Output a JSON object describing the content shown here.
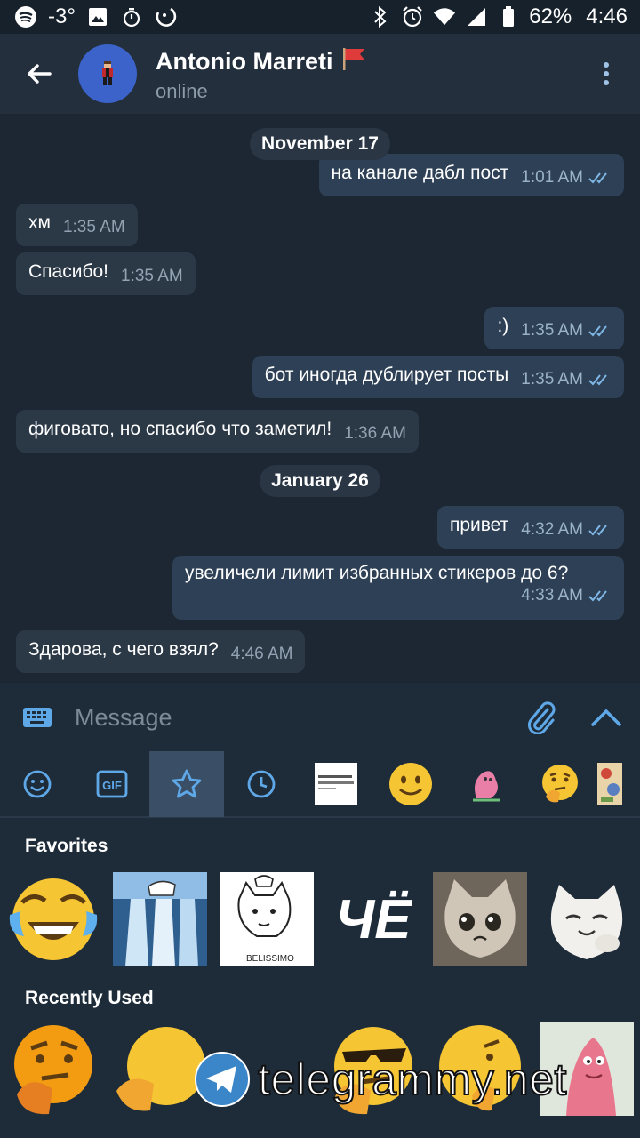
{
  "status_bar": {
    "temperature": "-3°",
    "battery": "62%",
    "time": "4:46"
  },
  "header": {
    "contact_name": "Antonio Marreti",
    "contact_status": "online",
    "name_flag_icon": "red-flag-icon"
  },
  "chat": {
    "date_chips": [
      "November 17",
      "January 26"
    ],
    "messages": [
      {
        "dir": "out",
        "text": "на канале дабл пост",
        "time": "1:01 AM",
        "read": true
      },
      {
        "dir": "in",
        "text": "хм",
        "time": "1:35 AM"
      },
      {
        "dir": "in",
        "text": "Спасибо!",
        "time": "1:35 AM"
      },
      {
        "dir": "out",
        "text": ":)",
        "time": "1:35 AM",
        "read": true
      },
      {
        "dir": "out",
        "text": "бот иногда дублирует посты",
        "time": "1:35 AM",
        "read": true
      },
      {
        "dir": "in",
        "text": "фиговато, но спасибо что заметил!",
        "time": "1:36 AM"
      },
      {
        "dir": "out",
        "text": "привет",
        "time": "4:32 AM",
        "read": true
      },
      {
        "dir": "out",
        "text": "увеличели лимит избранных стикеров до 6?",
        "time": "4:33 AM",
        "read": true
      },
      {
        "dir": "in",
        "text": "Здарова, с чего взял?",
        "time": "4:46 AM"
      }
    ]
  },
  "input": {
    "placeholder": "Message"
  },
  "sticker_tabs": [
    "emoji-icon",
    "gif-icon",
    "star-icon",
    "recent-clock-icon",
    "pack-text-sticker",
    "smiley-sticker",
    "pink-sticker",
    "thinking-sticker",
    "collage-sticker"
  ],
  "panel": {
    "favorites_title": "Favorites",
    "recent_title": "Recently Used",
    "favorites_ho_text": "ЧЁ",
    "belissimo_text": "BELISSIMO"
  },
  "watermark": "telegrammy.net",
  "colors": {
    "background": "#1d2733",
    "header": "#242f3d",
    "incoming_bubble": "#2b3846",
    "outgoing_bubble": "#2e4055",
    "accent": "#5fa8e8"
  }
}
